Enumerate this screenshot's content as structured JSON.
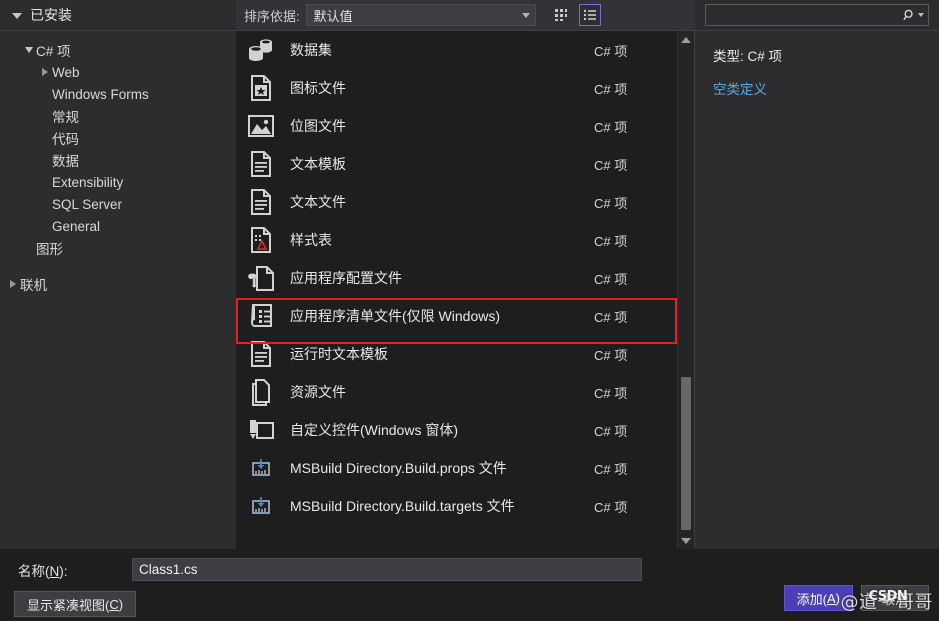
{
  "header": {
    "installed_label": "已安装",
    "sort_label": "排序依据:",
    "sort_value": "默认值",
    "tiles_view_icon": "grid-view-icon",
    "list_view_icon": "list-view-icon",
    "search_placeholder": "",
    "search_value": "",
    "search_icon": "search-icon"
  },
  "sidebar": {
    "items": [
      {
        "label": "C# 项",
        "indent": 1,
        "expander": "down",
        "id": "csharp-items"
      },
      {
        "label": "Web",
        "indent": 2,
        "expander": "right",
        "id": "web"
      },
      {
        "label": "Windows Forms",
        "indent": 2,
        "expander": "none",
        "id": "windows-forms"
      },
      {
        "label": "常规",
        "indent": 2,
        "expander": "none",
        "id": "general-cn"
      },
      {
        "label": "代码",
        "indent": 2,
        "expander": "none",
        "id": "code"
      },
      {
        "label": "数据",
        "indent": 2,
        "expander": "none",
        "id": "data"
      },
      {
        "label": "Extensibility",
        "indent": 2,
        "expander": "none",
        "id": "extensibility"
      },
      {
        "label": "SQL Server",
        "indent": 2,
        "expander": "none",
        "id": "sql-server"
      },
      {
        "label": "General",
        "indent": 2,
        "expander": "none",
        "id": "general-en"
      },
      {
        "label": "图形",
        "indent": 1,
        "expander": "none",
        "id": "graphics"
      },
      {
        "label": "",
        "indent": 0,
        "expander": "none",
        "id": "spacer"
      },
      {
        "label": "联机",
        "indent": 0,
        "expander": "right",
        "id": "online"
      }
    ]
  },
  "list": {
    "items": [
      {
        "label": "数据集",
        "type": "C# 项",
        "icon": "dataset-icon"
      },
      {
        "label": "图标文件",
        "type": "C# 项",
        "icon": "icon-file-icon"
      },
      {
        "label": "位图文件",
        "type": "C# 项",
        "icon": "bitmap-file-icon"
      },
      {
        "label": "文本模板",
        "type": "C# 项",
        "icon": "text-template-icon"
      },
      {
        "label": "文本文件",
        "type": "C# 项",
        "icon": "text-file-icon"
      },
      {
        "label": "样式表",
        "type": "C# 项",
        "icon": "stylesheet-icon"
      },
      {
        "label": "应用程序配置文件",
        "type": "C# 项",
        "icon": "app-config-file-icon"
      },
      {
        "label": "应用程序清单文件(仅限 Windows)",
        "type": "C# 项",
        "icon": "app-manifest-file-icon"
      },
      {
        "label": "运行时文本模板",
        "type": "C# 项",
        "icon": "runtime-text-template-icon"
      },
      {
        "label": "资源文件",
        "type": "C# 项",
        "icon": "resource-file-icon"
      },
      {
        "label": "自定义控件(Windows 窗体)",
        "type": "C# 项",
        "icon": "custom-control-icon"
      },
      {
        "label": "MSBuild Directory.Build.props 文件",
        "type": "C# 项",
        "icon": "msbuild-props-icon"
      },
      {
        "label": "MSBuild Directory.Build.targets 文件",
        "type": "C# 项",
        "icon": "msbuild-targets-icon"
      }
    ],
    "highlighted_index": 7,
    "highlight_color": "#ed1c24",
    "scrollbar": {
      "up_arrow": "scroll-up-icon",
      "down_arrow": "scroll-down-icon"
    }
  },
  "info": {
    "type_line": "类型: C# 项",
    "description": "空类定义"
  },
  "footer": {
    "name_label_pre": "名称(",
    "name_label_key": "N",
    "name_label_post": "):",
    "name_value": "Class1.cs",
    "compact_btn_pre": "显示紧凑视图(",
    "compact_btn_key": "C",
    "compact_btn_post": ")",
    "add_btn_pre": "添加(",
    "add_btn_key": "A",
    "add_btn_post": ")",
    "cancel_btn": "取消",
    "accent_color": "#4a3fb5"
  },
  "watermark": {
    "brand": "CSDN",
    "text": "@道一哥哥"
  }
}
